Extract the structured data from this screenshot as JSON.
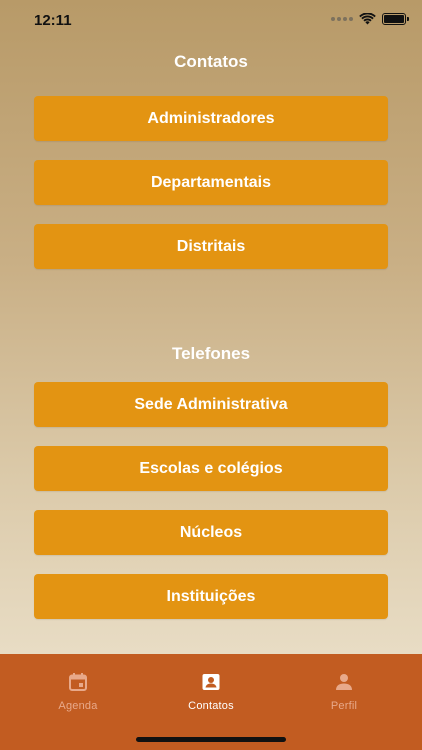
{
  "status_bar": {
    "time": "12:11"
  },
  "contatos_section": {
    "title": "Contatos",
    "buttons": [
      {
        "label": "Administradores"
      },
      {
        "label": "Departamentais"
      },
      {
        "label": "Distritais"
      }
    ]
  },
  "telefones_section": {
    "title": "Telefones",
    "buttons": [
      {
        "label": "Sede Administrativa"
      },
      {
        "label": "Escolas e colégios"
      },
      {
        "label": "Núcleos"
      },
      {
        "label": "Instituições"
      }
    ]
  },
  "tab_bar": {
    "tabs": [
      {
        "label": "Agenda",
        "icon": "calendar-icon",
        "active": false
      },
      {
        "label": "Contatos",
        "icon": "contact-card-icon",
        "active": true
      },
      {
        "label": "Perfil",
        "icon": "person-icon",
        "active": false
      }
    ]
  },
  "colors": {
    "button": "#e39412",
    "tab_bar": "#c25c21",
    "background_top": "#b89a68",
    "background_bottom": "#efe6d3"
  }
}
